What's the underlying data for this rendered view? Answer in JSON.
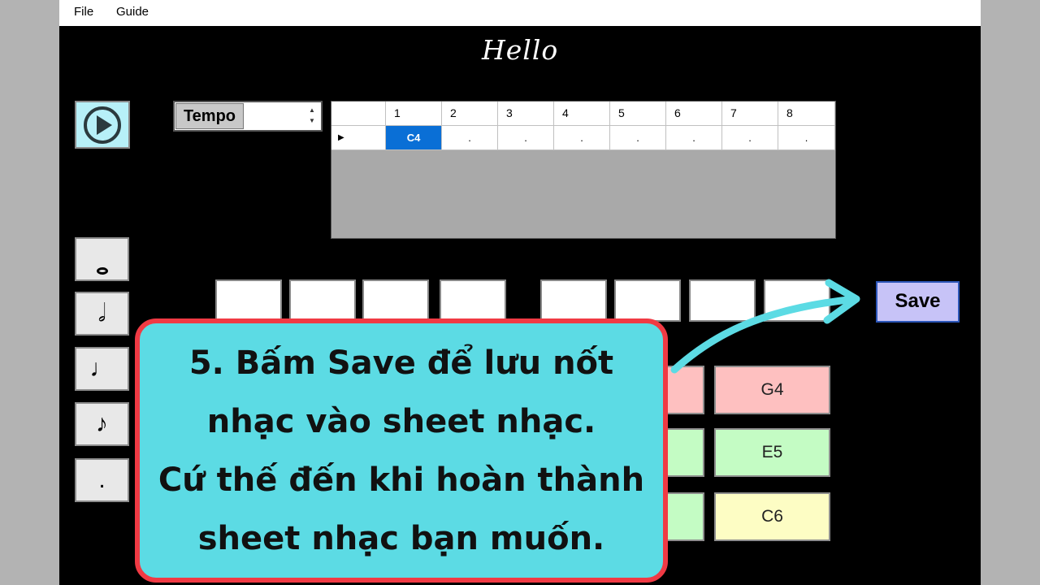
{
  "menu": {
    "file": "File",
    "guide": "Guide"
  },
  "app": {
    "title": "Hello"
  },
  "tempo": {
    "label": "Tempo",
    "value": "",
    "spin_up": "▲",
    "spin_down": "▼"
  },
  "grid": {
    "columns": [
      "",
      "1",
      "2",
      "3",
      "4",
      "5",
      "6",
      "7",
      "8"
    ],
    "row_marker": "▶",
    "cells": [
      "C4",
      ".",
      ".",
      ".",
      ".",
      ".",
      ".",
      "."
    ]
  },
  "note_buttons": [
    "𝅝",
    "𝅗𝅥",
    "♩",
    "♪",
    "."
  ],
  "save": {
    "label": "Save"
  },
  "keys": {
    "g4": "G4",
    "e5": "E5",
    "c6": "C6"
  },
  "callout": {
    "lines": [
      "5. Bấm Save để lưu nốt",
      "nhạc vào sheet nhạc.",
      "Cứ thế đến khi hoàn thành",
      "sheet nhạc bạn muốn."
    ]
  },
  "colors": {
    "key_red": "#fec0c0",
    "key_green": "#c4fcc4",
    "key_yellow": "#fdfdc4",
    "callout_bg": "#5cdbe4",
    "callout_border": "#f03a44",
    "arrow": "#5cdbe4"
  }
}
